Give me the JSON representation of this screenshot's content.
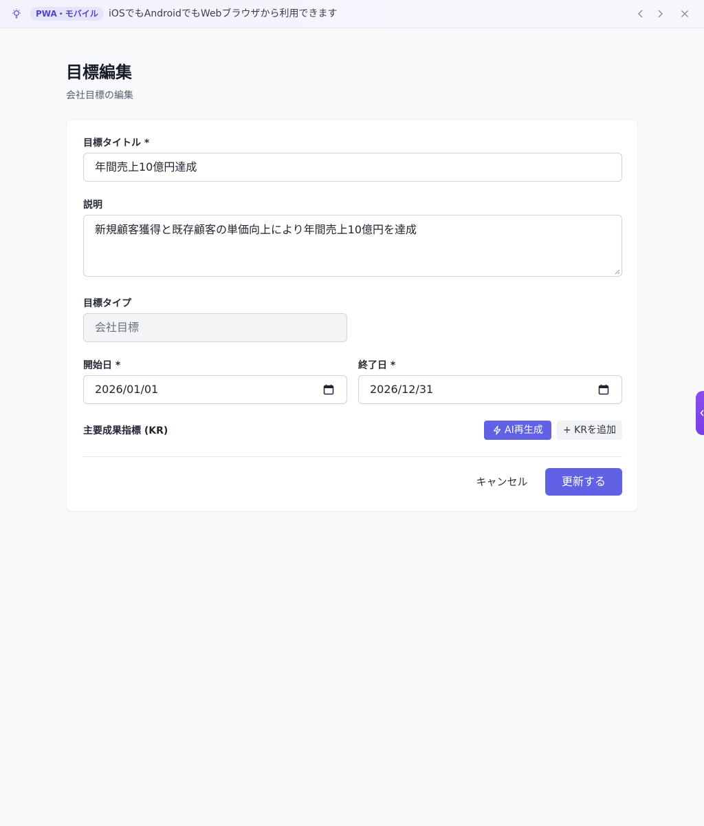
{
  "banner": {
    "badge": "PWA・モバイル",
    "message": "iOSでもAndroidでもWebブラウザから利用できます",
    "accent_color": "#4f46c8"
  },
  "page": {
    "title": "目標編集",
    "subtitle": "会社目標の編集"
  },
  "form": {
    "title_label": "目標タイトル *",
    "title_value": "年間売上10億円達成",
    "description_label": "説明",
    "description_value": "新規顧客獲得と既存顧客の単価向上により年間売上10億円を達成",
    "type_label": "目標タイプ",
    "type_value": "会社目標",
    "start_label": "開始日 *",
    "start_value": "2026/01/01",
    "end_label": "終了日 *",
    "end_value": "2026/12/31"
  },
  "kr": {
    "title": "主要成果指標 (KR)",
    "ai_button": "AI再生成",
    "add_button": "+ KRを追加"
  },
  "actions": {
    "cancel": "キャンセル",
    "submit": "更新する",
    "primary_color": "#6161e6"
  },
  "icons": {
    "banner": "lightbulb-icon",
    "prev": "chevron-left-icon",
    "next": "chevron-right-icon",
    "close": "close-icon",
    "ai": "zap-icon",
    "date": "calendar-icon"
  }
}
